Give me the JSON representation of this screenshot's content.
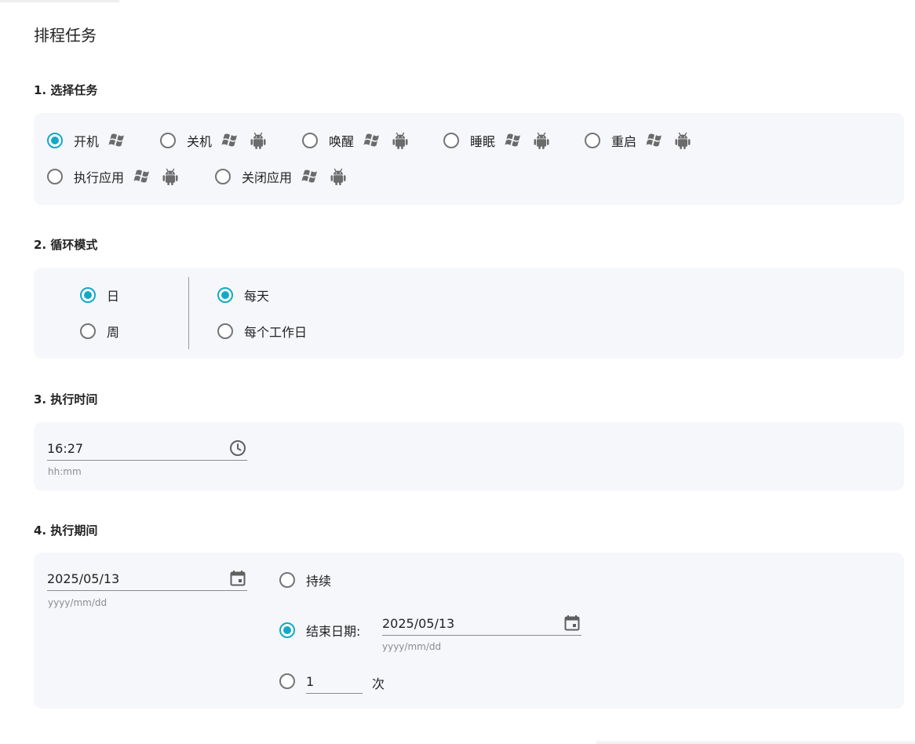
{
  "page_title": "排程任务",
  "sections": {
    "task": {
      "title": "1. 选择任务",
      "options": [
        {
          "label": "开机",
          "checked": true,
          "icons": [
            "windows-icon"
          ]
        },
        {
          "label": "关机",
          "checked": false,
          "icons": [
            "windows-icon",
            "android-icon"
          ]
        },
        {
          "label": "唤醒",
          "checked": false,
          "icons": [
            "windows-icon",
            "android-icon"
          ]
        },
        {
          "label": "睡眠",
          "checked": false,
          "icons": [
            "windows-icon",
            "android-icon"
          ]
        },
        {
          "label": "重启",
          "checked": false,
          "icons": [
            "windows-icon",
            "android-icon"
          ]
        },
        {
          "label": "执行应用",
          "checked": false,
          "icons": [
            "windows-icon",
            "android-icon"
          ]
        },
        {
          "label": "关闭应用",
          "checked": false,
          "icons": [
            "windows-icon",
            "android-icon"
          ]
        }
      ]
    },
    "loop": {
      "title": "2. 循环模式",
      "modes": [
        {
          "label": "日",
          "checked": true
        },
        {
          "label": "周",
          "checked": false
        }
      ],
      "sub_options": [
        {
          "label": "每天",
          "checked": true
        },
        {
          "label": "每个工作日",
          "checked": false
        }
      ]
    },
    "time": {
      "title": "3. 执行时间",
      "value": "16:27",
      "hint": "hh:mm",
      "icon": "clock-icon"
    },
    "period": {
      "title": "4. 执行期间",
      "start_date": "2025/05/13",
      "start_hint": "yyyy/mm/dd",
      "options": {
        "continuous": {
          "label": "持续",
          "checked": false
        },
        "end_date": {
          "label": "结束日期:",
          "checked": true,
          "value": "2025/05/13",
          "hint": "yyyy/mm/dd"
        },
        "count": {
          "value": "1",
          "suffix": "次",
          "checked": false
        }
      },
      "icon": "calendar-icon"
    }
  },
  "colors": {
    "accent": "#12a9c8",
    "panel_bg": "#f6f7fb",
    "icon_gray": "#6b6b6b"
  }
}
